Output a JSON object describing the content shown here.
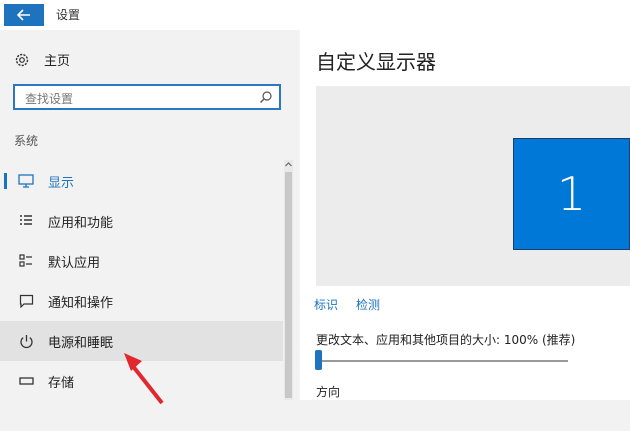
{
  "window": {
    "title": "设置"
  },
  "sidebar": {
    "home_label": "主页",
    "search": {
      "placeholder": "查找设置"
    },
    "section_title": "系统",
    "items": [
      {
        "label": "显示",
        "icon": "monitor-icon"
      },
      {
        "label": "应用和功能",
        "icon": "list-icon"
      },
      {
        "label": "默认应用",
        "icon": "default-apps-icon"
      },
      {
        "label": "通知和操作",
        "icon": "notification-icon"
      },
      {
        "label": "电源和睡眠",
        "icon": "power-icon"
      },
      {
        "label": "存储",
        "icon": "storage-icon"
      }
    ]
  },
  "main": {
    "heading": "自定义显示器",
    "monitor_number": "1",
    "links": {
      "identify": "标识",
      "detect": "检测"
    },
    "scale_label": "更改文本、应用和其他项目的大小: 100% (推荐)",
    "orientation_label": "方向"
  },
  "colors": {
    "accent": "#1e73be",
    "monitor": "#0078d7",
    "annotation_arrow": "#e0282e"
  }
}
